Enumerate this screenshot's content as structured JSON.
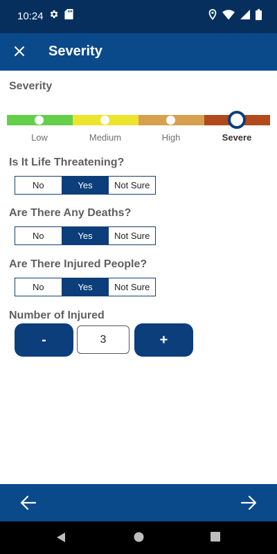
{
  "status_bar": {
    "time": "10:24",
    "left_icons": [
      "gear-icon",
      "sd-card-icon"
    ],
    "right_icons": [
      "location-icon",
      "wifi-icon",
      "signal-icon",
      "battery-icon"
    ]
  },
  "app_bar": {
    "title": "Severity",
    "close_icon": "close-icon"
  },
  "severity": {
    "title": "Severity",
    "levels": [
      "Low",
      "Medium",
      "High",
      "Severe"
    ],
    "selected": "Severe",
    "colors": [
      "#63cf4b",
      "#ece42d",
      "#d6a04f",
      "#b14a1c"
    ]
  },
  "questions": [
    {
      "title": "Is It Life Threatening?",
      "options": [
        "No",
        "Yes",
        "Not Sure"
      ],
      "selected": "Yes"
    },
    {
      "title": "Are There Any Deaths?",
      "options": [
        "No",
        "Yes",
        "Not Sure"
      ],
      "selected": "Yes"
    },
    {
      "title": "Are There Injured People?",
      "options": [
        "No",
        "Yes",
        "Not Sure"
      ],
      "selected": "Yes"
    }
  ],
  "injured": {
    "title": "Number of Injured",
    "decrement_label": "-",
    "value": "3",
    "increment_label": "+"
  },
  "bottom_nav": {
    "back_icon": "arrow-left-icon",
    "next_icon": "arrow-right-icon"
  },
  "system_nav": [
    "back-triangle-icon",
    "home-circle-icon",
    "recents-square-icon"
  ],
  "theme": {
    "primary": "#0b4a8a",
    "dark": "#062f5e",
    "selected": "#0b3e7a"
  }
}
